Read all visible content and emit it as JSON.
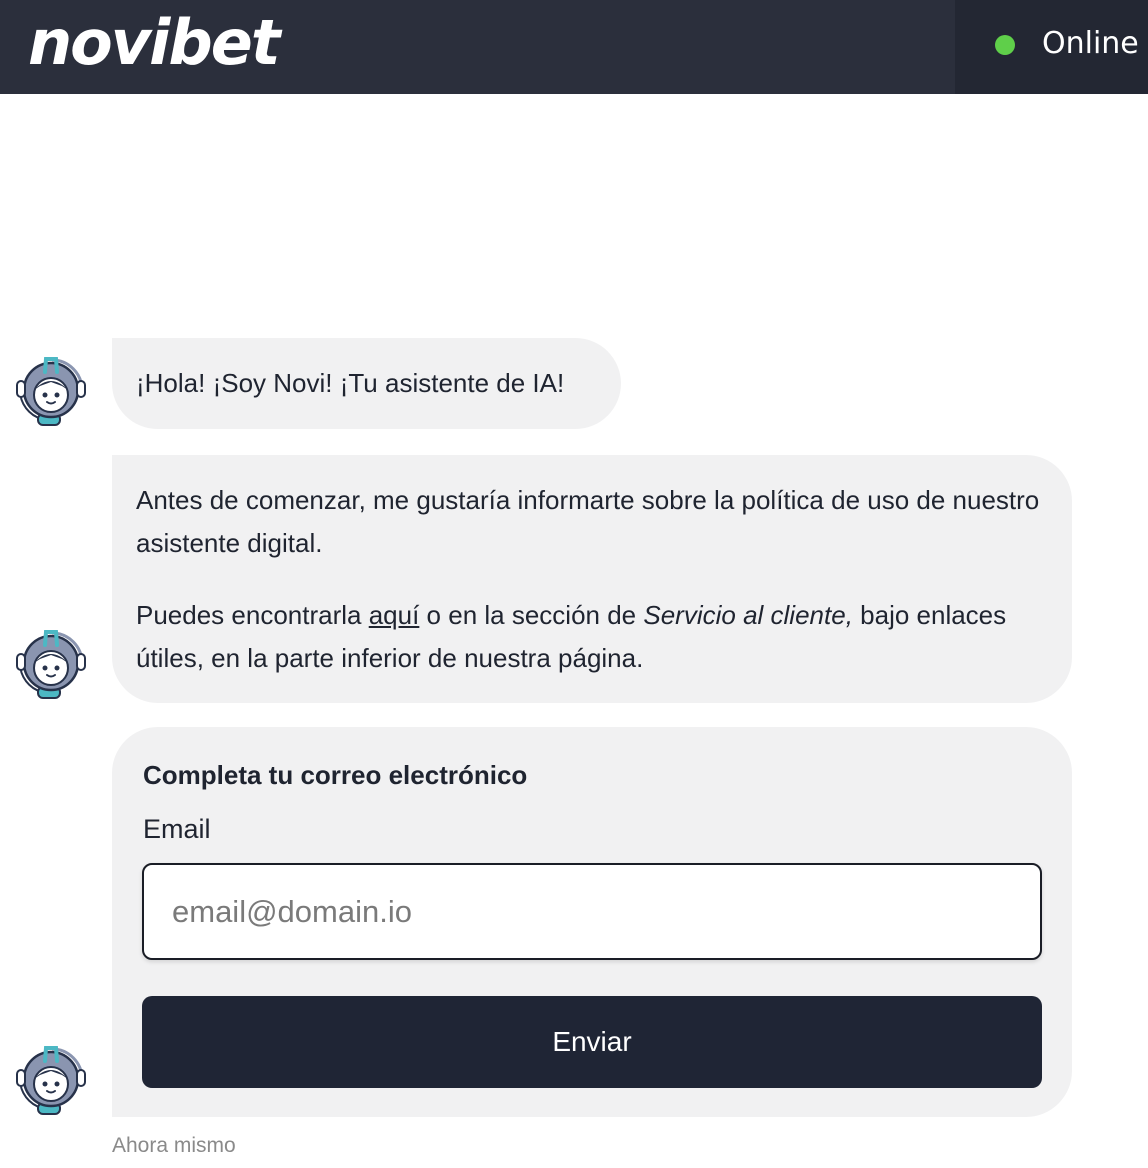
{
  "header": {
    "brand": "novibet",
    "status_label": "Online",
    "status_color": "#5fcf4a",
    "background": "#2b2f3c"
  },
  "chat": {
    "avatar_icon": "bot-avatar-icon",
    "messages": [
      {
        "text": "¡Hola! ¡Soy Novi! ¡Tu asistente de IA!"
      },
      {
        "paragraph1": "Antes de comenzar, me gustaría informarte sobre la política de uso de nuestro asistente digital.",
        "p2_before": "Puedes encontrarla ",
        "p2_link": "aquí",
        "p2_middle": " o en la sección de ",
        "p2_italic": "Servicio al cliente,",
        "p2_after": " bajo enlaces útiles, en la parte inferior de nuestra página."
      }
    ],
    "form": {
      "title": "Completa tu correo electrónico",
      "email_label": "Email",
      "email_placeholder": "email@domain.io",
      "email_value": "",
      "submit_label": "Enviar"
    },
    "timestamp": "Ahora mismo"
  }
}
